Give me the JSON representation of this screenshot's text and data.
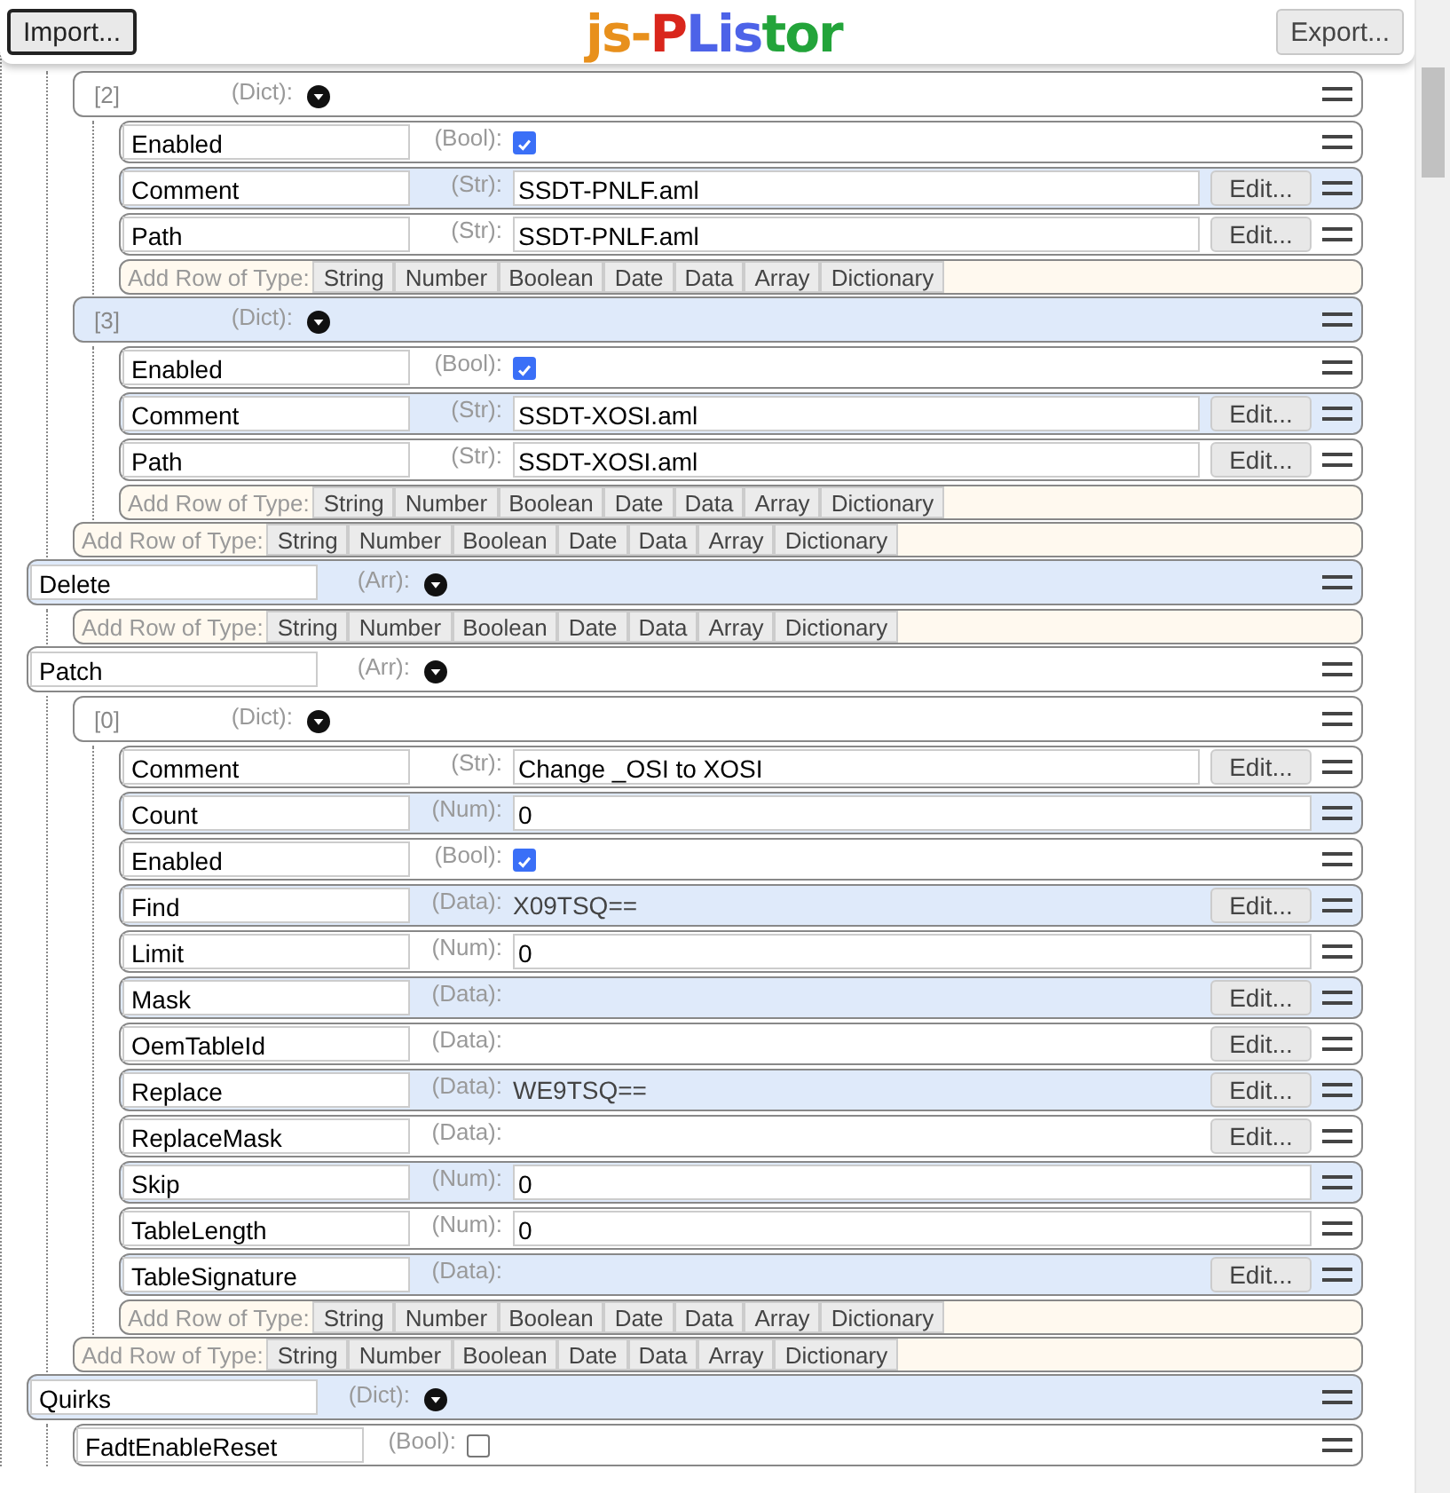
{
  "header": {
    "import_button": "Import...",
    "title": [
      {
        "text": "js-",
        "color": "#e8901c"
      },
      {
        "text": "P",
        "color": "#d9261c"
      },
      {
        "text": "Lis",
        "color": "#4d63e8"
      },
      {
        "text": "tor",
        "color": "#23a43a"
      }
    ],
    "export_button": "Export..."
  },
  "tree": [
    {
      "kind": "continued",
      "children": [
        {
          "kind": "dict",
          "index": "[2]",
          "type": "(Dict):",
          "shaded": false,
          "children": [
            {
              "kind": "bool",
              "key": "Enabled",
              "type": "(Bool):",
              "checked": true,
              "shaded": false
            },
            {
              "kind": "str",
              "key": "Comment",
              "type": "(Str):",
              "value": "SSDT-PNLF.aml",
              "edit": "Edit...",
              "shaded": true
            },
            {
              "kind": "str",
              "key": "Path",
              "type": "(Str):",
              "value": "SSDT-PNLF.aml",
              "edit": "Edit...",
              "shaded": false
            }
          ],
          "add_row": {
            "label": "Add Row of Type:",
            "types": [
              "String",
              "Number",
              "Boolean",
              "Date",
              "Data",
              "Array",
              "Dictionary"
            ]
          }
        },
        {
          "kind": "dict",
          "index": "[3]",
          "type": "(Dict):",
          "shaded": true,
          "children": [
            {
              "kind": "bool",
              "key": "Enabled",
              "type": "(Bool):",
              "checked": true,
              "shaded": false
            },
            {
              "kind": "str",
              "key": "Comment",
              "type": "(Str):",
              "value": "SSDT-XOSI.aml",
              "edit": "Edit...",
              "shaded": true
            },
            {
              "kind": "str",
              "key": "Path",
              "type": "(Str):",
              "value": "SSDT-XOSI.aml",
              "edit": "Edit...",
              "shaded": false
            }
          ],
          "add_row": {
            "label": "Add Row of Type:",
            "types": [
              "String",
              "Number",
              "Boolean",
              "Date",
              "Data",
              "Array",
              "Dictionary"
            ]
          }
        }
      ],
      "add_row": {
        "label": "Add Row of Type:",
        "types": [
          "String",
          "Number",
          "Boolean",
          "Date",
          "Data",
          "Array",
          "Dictionary"
        ]
      }
    },
    {
      "kind": "arr",
      "key": "Delete",
      "type": "(Arr):",
      "shaded": true,
      "add_row": {
        "label": "Add Row of Type:",
        "types": [
          "String",
          "Number",
          "Boolean",
          "Date",
          "Data",
          "Array",
          "Dictionary"
        ]
      }
    },
    {
      "kind": "arr",
      "key": "Patch",
      "type": "(Arr):",
      "shaded": false,
      "children": [
        {
          "kind": "dict",
          "index": "[0]",
          "type": "(Dict):",
          "shaded": false,
          "children": [
            {
              "kind": "str",
              "key": "Comment",
              "type": "(Str):",
              "value": "Change _OSI to XOSI",
              "edit": "Edit...",
              "shaded": false
            },
            {
              "kind": "num",
              "key": "Count",
              "type": "(Num):",
              "value": "0",
              "shaded": true
            },
            {
              "kind": "bool",
              "key": "Enabled",
              "type": "(Bool):",
              "checked": true,
              "shaded": false
            },
            {
              "kind": "data",
              "key": "Find",
              "type": "(Data):",
              "value": "X09TSQ==",
              "edit": "Edit...",
              "shaded": true
            },
            {
              "kind": "num",
              "key": "Limit",
              "type": "(Num):",
              "value": "0",
              "shaded": false
            },
            {
              "kind": "data",
              "key": "Mask",
              "type": "(Data):",
              "edit": "Edit...",
              "shaded": true
            },
            {
              "kind": "data",
              "key": "OemTableId",
              "type": "(Data):",
              "edit": "Edit...",
              "shaded": false
            },
            {
              "kind": "data",
              "key": "Replace",
              "type": "(Data):",
              "value": "WE9TSQ==",
              "edit": "Edit...",
              "shaded": true
            },
            {
              "kind": "data",
              "key": "ReplaceMask",
              "type": "(Data):",
              "edit": "Edit...",
              "shaded": false
            },
            {
              "kind": "num",
              "key": "Skip",
              "type": "(Num):",
              "value": "0",
              "shaded": true
            },
            {
              "kind": "num",
              "key": "TableLength",
              "type": "(Num):",
              "value": "0",
              "shaded": false
            },
            {
              "kind": "data",
              "key": "TableSignature",
              "type": "(Data):",
              "edit": "Edit...",
              "shaded": true
            }
          ],
          "add_row": {
            "label": "Add Row of Type:",
            "types": [
              "String",
              "Number",
              "Boolean",
              "Date",
              "Data",
              "Array",
              "Dictionary"
            ]
          }
        }
      ],
      "add_row": {
        "label": "Add Row of Type:",
        "types": [
          "String",
          "Number",
          "Boolean",
          "Date",
          "Data",
          "Array",
          "Dictionary"
        ]
      }
    },
    {
      "kind": "dict",
      "key": "Quirks",
      "type": "(Dict):",
      "shaded": true,
      "children": [
        {
          "kind": "bool",
          "key": "FadtEnableReset",
          "type": "(Bool):",
          "checked": false,
          "shaded": false
        }
      ]
    }
  ]
}
